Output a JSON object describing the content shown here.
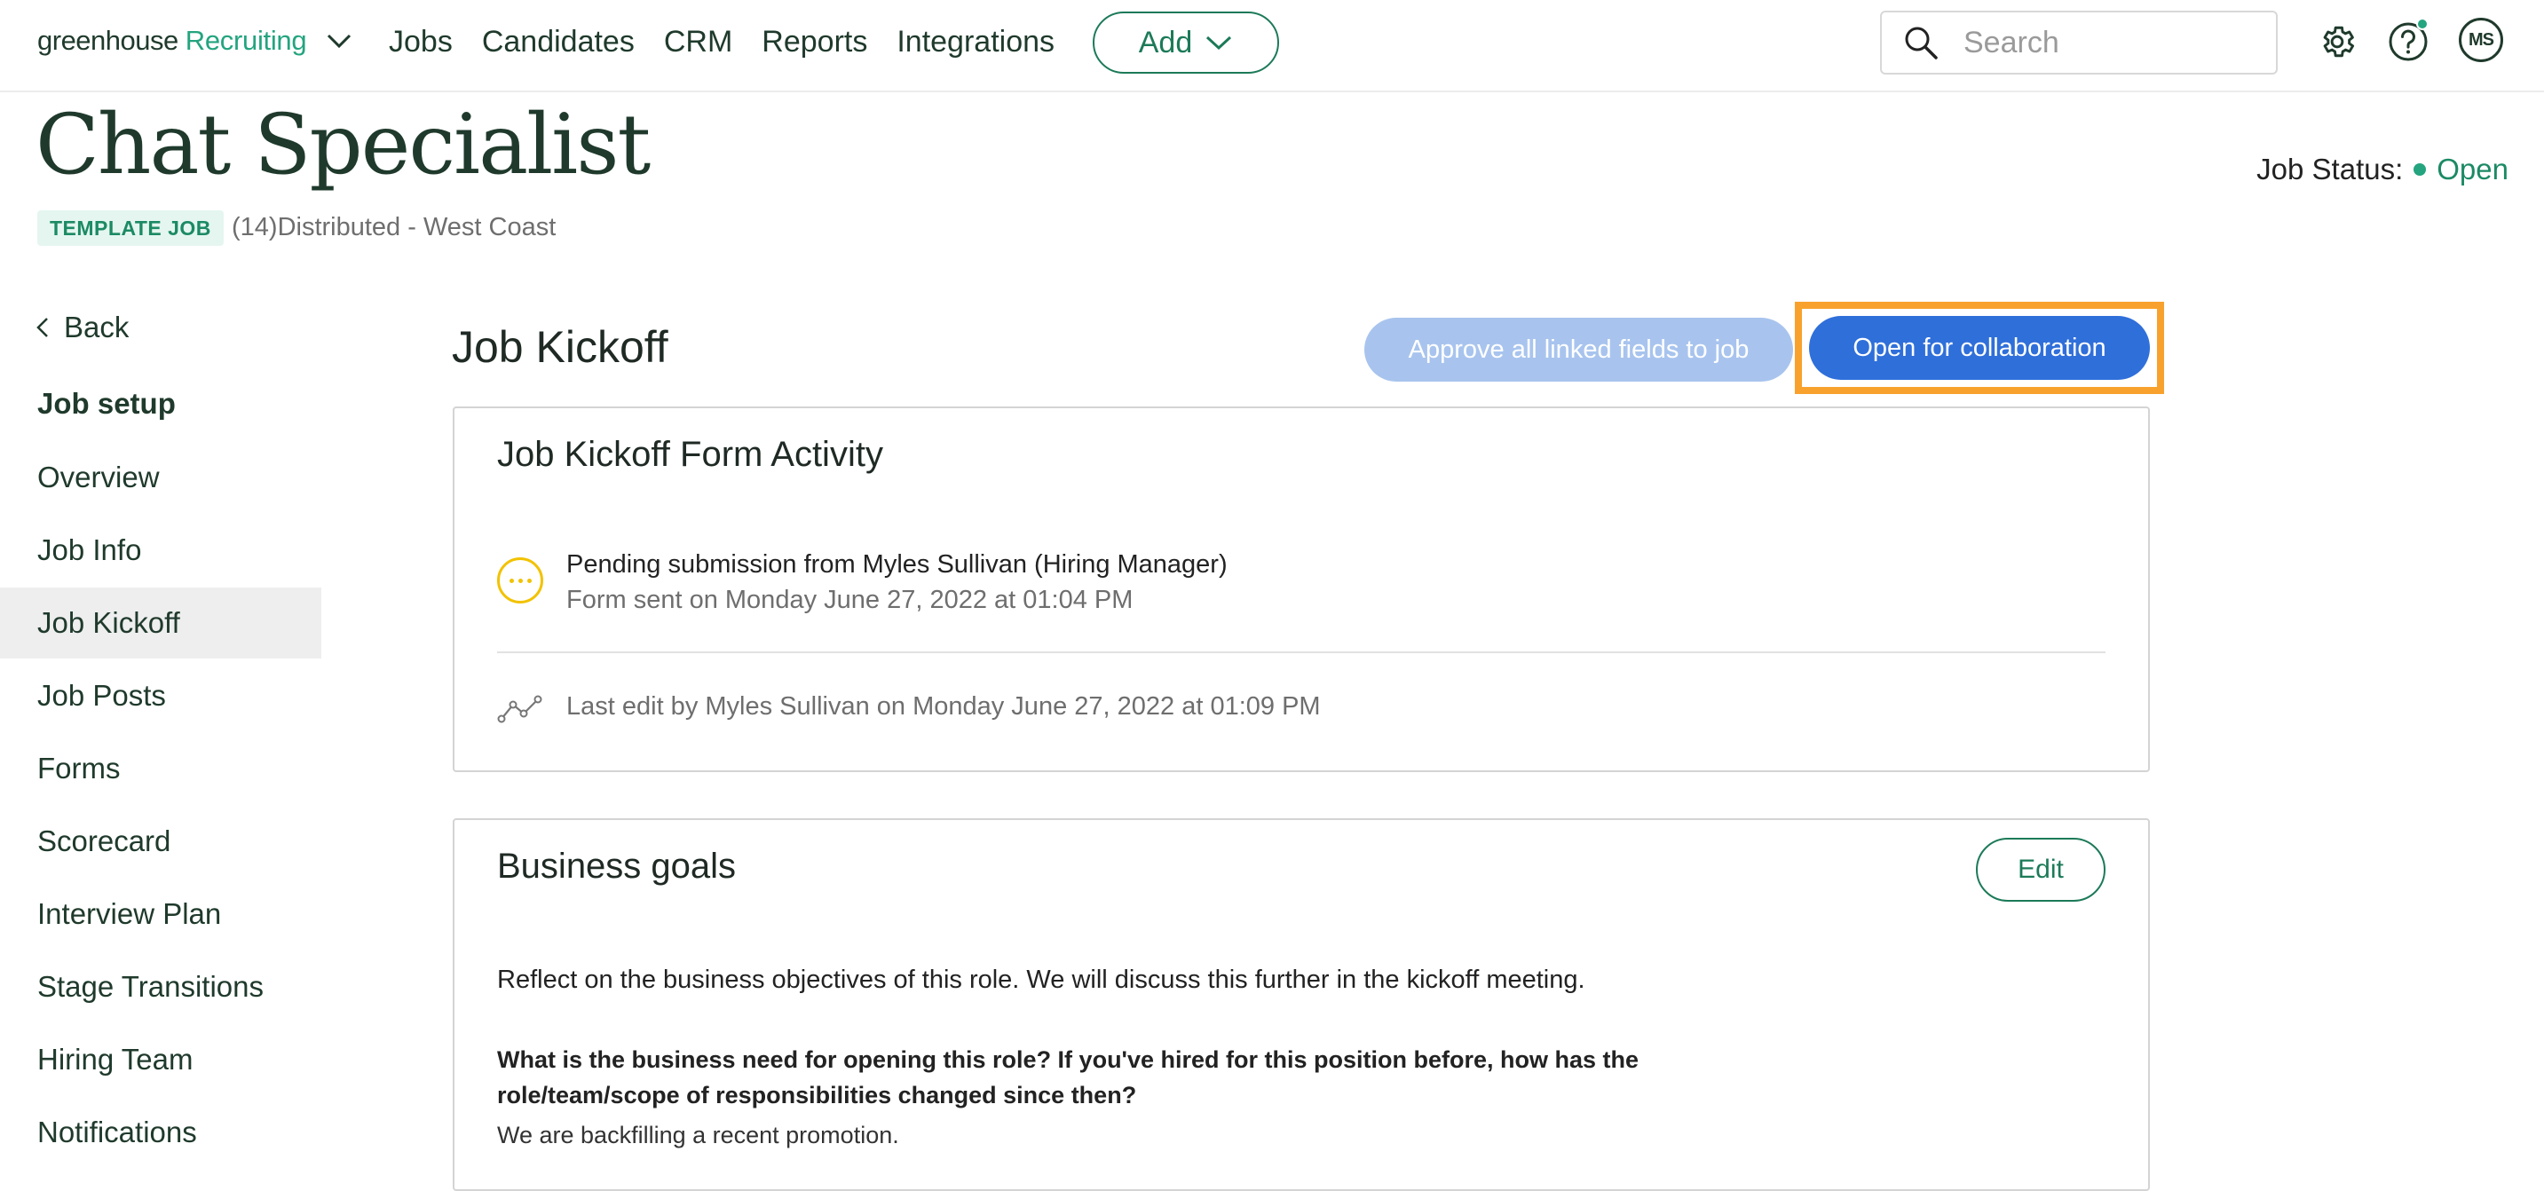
{
  "nav": {
    "brand_main": "greenhouse",
    "brand_product": "Recruiting",
    "links": [
      "Jobs",
      "Candidates",
      "CRM",
      "Reports",
      "Integrations"
    ],
    "add_label": "Add",
    "search_placeholder": "Search",
    "avatar_initials": "MS"
  },
  "job": {
    "title": "Chat Specialist",
    "badge": "TEMPLATE JOB",
    "subtitle": "(14)Distributed - West Coast",
    "status_label": "Job Status:",
    "status_value": "Open"
  },
  "sidebar": {
    "back_label": "Back",
    "heading": "Job setup",
    "items": [
      "Overview",
      "Job Info",
      "Job Kickoff",
      "Job Posts",
      "Forms",
      "Scorecard",
      "Interview Plan",
      "Stage Transitions",
      "Hiring Team",
      "Notifications"
    ],
    "active_item": "Job Kickoff"
  },
  "main": {
    "section_title": "Job Kickoff",
    "approve_button": "Approve all linked fields to job",
    "collaboration_button": "Open for collaboration",
    "activity_card": {
      "title": "Job Kickoff Form Activity",
      "pending_text": "Pending submission from Myles Sullivan (Hiring Manager)",
      "form_sent_text": "Form sent on Monday June 27, 2022 at 01:04 PM",
      "last_edit_text": "Last edit by Myles Sullivan on Monday June 27, 2022 at 01:09 PM"
    },
    "goals_card": {
      "title": "Business goals",
      "edit_button": "Edit",
      "intro": "Reflect on the business objectives of this role. We will discuss this further in the kickoff meeting.",
      "question": "What is the business need for opening this role? If you've hired for this position before, how has the role/team/scope of responsibilities changed since then?",
      "answer": "We are backfilling a recent promotion."
    }
  },
  "colors": {
    "brand_green": "#24a47f",
    "dark_green": "#1f3a2c",
    "primary_blue": "#2f6fda",
    "disabled_blue": "#a8c4ee",
    "highlight_orange": "#f8a22d",
    "pending_yellow": "#f2c200"
  },
  "icons": {
    "brand_dropdown": "chevron-down-icon",
    "add_dropdown": "chevron-down-icon",
    "search": "search-icon",
    "settings": "gear-icon",
    "help": "help-icon",
    "back": "chevron-left-icon",
    "pending": "pending-icon",
    "last_edit": "activity-icon"
  }
}
